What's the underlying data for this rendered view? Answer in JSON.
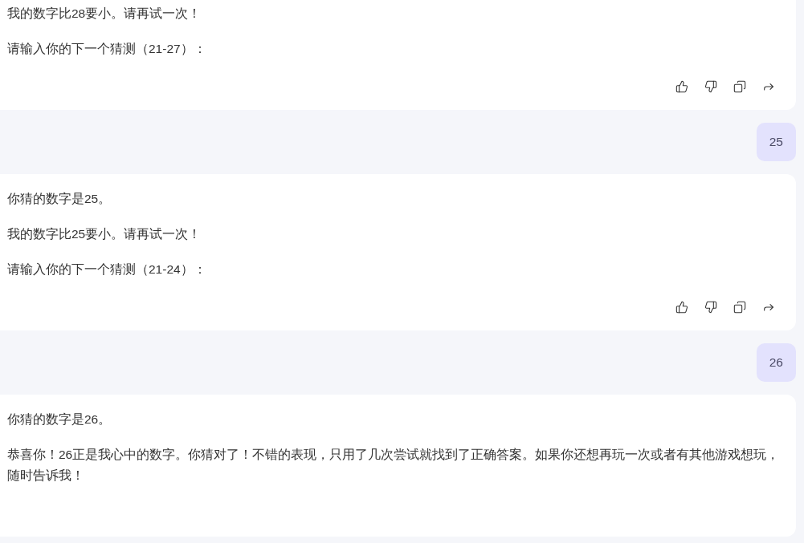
{
  "messages": [
    {
      "kind": "assistant",
      "paragraphs": [
        "我的数字比28要小。请再试一次！",
        "请输入你的下一个猜测（21-27）："
      ],
      "has_actions": true
    },
    {
      "kind": "user",
      "text": "25"
    },
    {
      "kind": "assistant",
      "paragraphs": [
        "你猜的数字是25。",
        "我的数字比25要小。请再试一次！",
        "请输入你的下一个猜测（21-24）："
      ],
      "has_actions": true
    },
    {
      "kind": "user",
      "text": "26"
    },
    {
      "kind": "assistant",
      "paragraphs": [
        "你猜的数字是26。",
        "恭喜你！26正是我心中的数字。你猜对了！不错的表现，只用了几次尝试就找到了正确答案。如果你还想再玩一次或者有其他游戏想玩，随时告诉我！"
      ],
      "has_actions": false
    }
  ]
}
